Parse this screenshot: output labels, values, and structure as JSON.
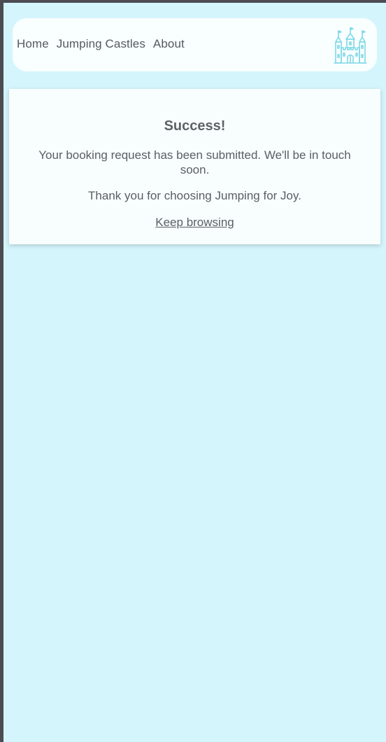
{
  "nav": {
    "links": [
      {
        "label": "Home"
      },
      {
        "label": "Jumping Castles"
      },
      {
        "label": "About"
      }
    ],
    "logo_icon": "castle-icon"
  },
  "success": {
    "title": "Success!",
    "message": "Your booking request has been submitted. We'll be in touch soon.",
    "thanks": "Thank you for choosing Jumping for Joy.",
    "link_label": "Keep browsing"
  },
  "colors": {
    "page_background": "#d4f5fc",
    "card_background": "#f8fdfe",
    "text": "#5a5f63",
    "logo": "#7fd9e6",
    "frame": "#4b4d52"
  }
}
